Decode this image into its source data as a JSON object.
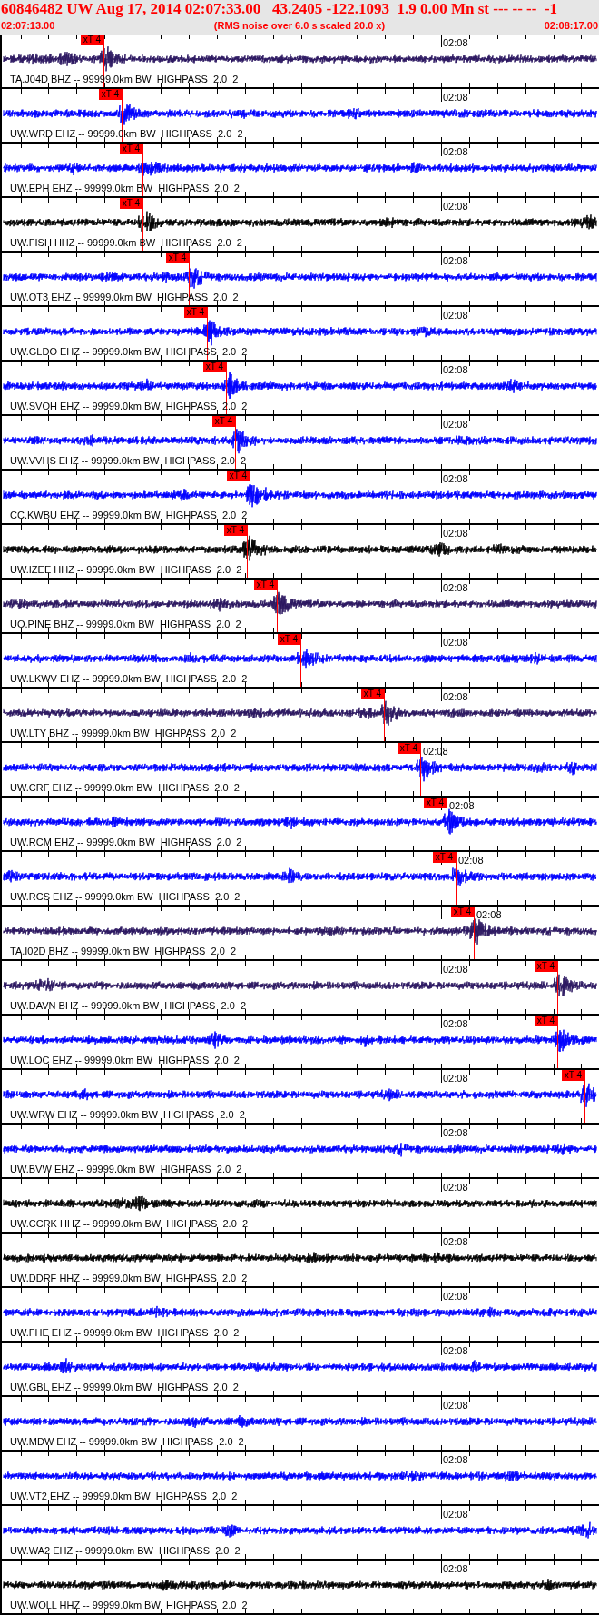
{
  "header": {
    "title": "60846482 UW Aug 17, 2014 02:07:33.00   43.2405 -122.1093  1.9 0.00 Mn st --- -- --  -1",
    "start_time": "02:07:13.00",
    "note": "(RMS noise over 6.0 s scaled 20.0 x)",
    "end_time": "02:08:17.00"
  },
  "traces": [
    {
      "label": "TA.J04D BHZ -- 99999.0km BW  HIGHPASS  2.0  2",
      "time_label": "02:08",
      "color": "#2b1660",
      "pick": {
        "label": "xT 4",
        "level": 0.17
      }
    },
    {
      "label": "UW.WRD EHZ -- 99999.0km BW  HIGHPASS  2.0  2",
      "time_label": "02:08",
      "color": "#0000ff",
      "pick": {
        "label": "xT 4",
        "level": 0.2
      }
    },
    {
      "label": "UW.EPH EHZ -- 99999.0km BW  HIGHPASS  2.0  2",
      "time_label": "02:08",
      "color": "#0000ff",
      "pick": {
        "label": "xT 4",
        "level": 0.235
      }
    },
    {
      "label": "UW.FISH HHZ -- 99999.0km BW  HIGHPASS  2.0  2",
      "time_label": "02:08",
      "color": "#000000",
      "pick": {
        "label": "xT 4",
        "level": 0.235
      }
    },
    {
      "label": "UW.OT3 EHZ -- 99999.0km BW  HIGHPASS  2.0  2",
      "time_label": "02:08",
      "color": "#0000ff",
      "pick": {
        "label": "xT 4",
        "level": 0.313
      }
    },
    {
      "label": "UW.GLDO EHZ -- 99999.0km BW  HIGHPASS  2.0  2",
      "time_label": "02:08",
      "color": "#0000ff",
      "pick": {
        "label": "xT 4",
        "level": 0.344
      }
    },
    {
      "label": "UW.SVOH EHZ -- 99999.0km BW  HIGHPASS  2.0  2",
      "time_label": "02:08",
      "color": "#0000ff",
      "pick": {
        "label": "xT 4",
        "level": 0.376
      }
    },
    {
      "label": "UW.VVHS EHZ -- 99999.0km BW  HIGHPASS  2.0  2",
      "time_label": "02:08",
      "color": "#0000ff",
      "pick": {
        "label": "xT 4",
        "level": 0.39
      }
    },
    {
      "label": "CC.KWBU EHZ -- 99999.0km BW  HIGHPASS  2.0  2",
      "time_label": "02:08",
      "color": "#0000ff",
      "pick": {
        "label": "xT 4",
        "level": 0.415
      }
    },
    {
      "label": "UW.IZEE HHZ -- 99999.0km BW  HIGHPASS  2.0  2",
      "time_label": "02:08",
      "color": "#000000",
      "pick": {
        "label": "xT 4",
        "level": 0.41
      }
    },
    {
      "label": "UO.PINE BHZ -- 99999.0km BW  HIGHPASS  2.0  2",
      "time_label": "02:08",
      "color": "#2b1660",
      "pick": {
        "label": "xT 4",
        "level": 0.46
      }
    },
    {
      "label": "UW.LKWV EHZ -- 99999.0km BW  HIGHPASS  2.0  2",
      "time_label": "02:08",
      "color": "#0000ff",
      "pick": {
        "label": "xT 4",
        "level": 0.5
      }
    },
    {
      "label": "UW.LTY BHZ -- 99999.0km BW  HIGHPASS  2.0  2",
      "time_label": "02:08",
      "color": "#2b1660",
      "pick": {
        "label": "xT 4",
        "level": 0.64
      }
    },
    {
      "label": "UW.CRF EHZ -- 99999.0km BW  HIGHPASS  2.0  2",
      "time_label": "02:08",
      "color": "#0000ff",
      "pick": {
        "label": "xT 4",
        "level": 0.7
      }
    },
    {
      "label": "UW.RCM EHZ -- 99999.0km BW  HIGHPASS  2.0  2",
      "time_label": "02:08",
      "color": "#0000ff",
      "pick": {
        "label": "xT 4",
        "level": 0.744
      }
    },
    {
      "label": "UW.RCS EHZ -- 99999.0km BW  HIGHPASS  2.0  2",
      "time_label": "02:08",
      "color": "#0000ff",
      "pick": {
        "label": "xT 4",
        "level": 0.76
      }
    },
    {
      "label": "TA.I02D BHZ -- 99999.0km BW  HIGHPASS  2.0  2",
      "time_label": "02:08",
      "color": "#2b1660",
      "pick": {
        "label": "xT 4",
        "level": 0.79
      }
    },
    {
      "label": "UW.DAVN BHZ -- 99999.0km BW  HIGHPASS  2.0  2",
      "time_label": "02:08",
      "color": "#2b1660",
      "pick": {
        "label": "xT 4",
        "level": 0.93
      }
    },
    {
      "label": "UW.LOC EHZ -- 99999.0km BW  HIGHPASS  2.0  2",
      "time_label": "02:08",
      "color": "#0000ff",
      "pick": {
        "label": "xT 4",
        "level": 0.93
      }
    },
    {
      "label": "UW.WRW EHZ -- 99999.0km BW  HIGHPASS  2.0  2",
      "time_label": "02:08",
      "color": "#0000ff",
      "pick": {
        "label": "xT 4",
        "level": 0.975
      }
    },
    {
      "label": "UW.BVW EHZ -- 99999.0km BW  HIGHPASS  2.0  2",
      "time_label": "02:08",
      "color": "#0000ff"
    },
    {
      "label": "UW.CCRK HHZ -- 99999.0km BW  HIGHPASS  2.0  2",
      "time_label": "02:08",
      "color": "#000000"
    },
    {
      "label": "UW.DDRF HHZ -- 99999.0km BW  HIGHPASS  2.0  2",
      "time_label": "02:08",
      "color": "#000000"
    },
    {
      "label": "UW.FHE EHZ -- 99999.0km BW  HIGHPASS  2.0  2",
      "time_label": "02:08",
      "color": "#0000ff"
    },
    {
      "label": "UW.GBL EHZ -- 99999.0km BW  HIGHPASS  2.0  2",
      "time_label": "02:08",
      "color": "#0000ff"
    },
    {
      "label": "UW.MDW EHZ -- 99999.0km BW  HIGHPASS  2.0  2",
      "time_label": "02:08",
      "color": "#0000ff"
    },
    {
      "label": "UW.VT2 EHZ -- 99999.0km BW  HIGHPASS  2.0  2",
      "time_label": "02:08",
      "color": "#0000ff"
    },
    {
      "label": "UW.WA2 EHZ -- 99999.0km BW  HIGHPASS  2.0  2",
      "time_label": "02:08",
      "color": "#0000ff"
    },
    {
      "label": "UW.WOLL HHZ -- 99999.0km BW  HIGHPASS  2.0  2",
      "time_label": "02:08",
      "color": "#000000"
    }
  ]
}
